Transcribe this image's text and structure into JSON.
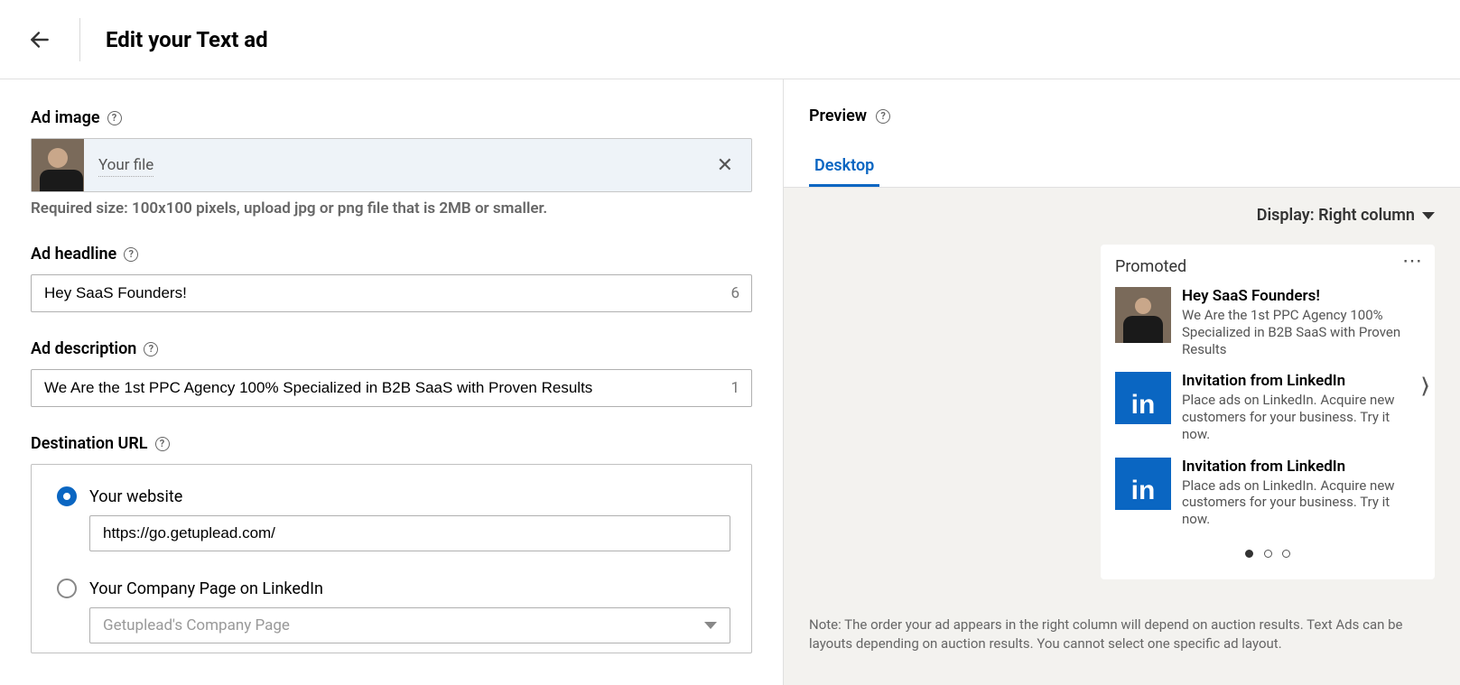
{
  "header": {
    "title": "Edit your Text ad"
  },
  "adImage": {
    "label": "Ad image",
    "fileLabel": "Your file",
    "hint": "Required size: 100x100 pixels, upload jpg or png file that is 2MB or smaller."
  },
  "headline": {
    "label": "Ad headline",
    "value": "Hey SaaS Founders!",
    "remaining": "6"
  },
  "description": {
    "label": "Ad description",
    "value": "We Are the 1st PPC Agency 100% Specialized in B2B SaaS with Proven Results",
    "remaining": "1"
  },
  "destination": {
    "label": "Destination URL",
    "options": {
      "website": {
        "label": "Your website",
        "value": "https://go.getuplead.com/"
      },
      "company": {
        "label": "Your Company Page on LinkedIn",
        "placeholder": "Getuplead's Company Page"
      }
    }
  },
  "preview": {
    "title": "Preview",
    "tab": "Desktop",
    "displayLabel": "Display: Right column",
    "card": {
      "badge": "Promoted",
      "main": {
        "title": "Hey SaaS Founders!",
        "body": "We Are the 1st PPC Agency 100% Specialized in B2B SaaS with Proven Results"
      },
      "filler": {
        "title": "Invitation from LinkedIn",
        "body": "Place ads on LinkedIn. Acquire new customers for your business. Try it now."
      }
    },
    "note": "Note: The order your ad appears in the right column will depend on auction results. Text Ads can be layouts depending on auction results. You cannot select one specific ad layout."
  }
}
